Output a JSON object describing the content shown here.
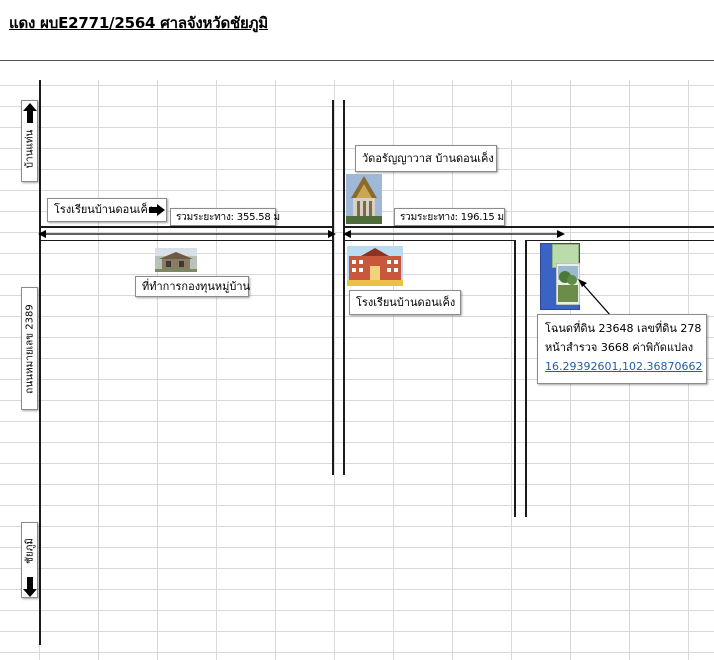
{
  "header": {
    "title": "แดง ผบE2771/2564   ศาลจังหวัดชัยภูมิ"
  },
  "map": {
    "directions": {
      "north_town": "บ้านแท่น",
      "south_town": "ชัยภูมิ",
      "west_road": "ถนนหมายเลข 2389"
    },
    "landmarks": {
      "school_left": "โรงเรียนบ้านดอนเค็ง",
      "village_fund_office": "ที่ทำการกองทุนหมู่บ้าน",
      "temple": "วัดอรัญญาวาส บ้านดอนเค็ง",
      "school_center": "โรงเรียนบ้านดอนเค็ง"
    },
    "distances": {
      "left_segment": "รวมระยะทาง: 355.58 ม",
      "right_segment": "รวมระยะทาง: 196.15 ม"
    },
    "deed": {
      "line1": "โฉนดที่ดิน 23648 เลขที่ดิน 278",
      "line2": "หน้าสำรวจ 3668 ค่าพิกัดแปลง",
      "coordinates": "16.29392601,102.36870662"
    },
    "icons": {
      "north_arrow": "arrow-up-icon",
      "south_arrow": "arrow-down-icon",
      "direction_arrow": "arrow-right-icon"
    },
    "colors": {
      "plot_fill": "#3b63c4",
      "plot_highlight": "#b9dcaa",
      "coordinate_link": "#1f5fa8",
      "road": "#1a1a1a"
    }
  }
}
